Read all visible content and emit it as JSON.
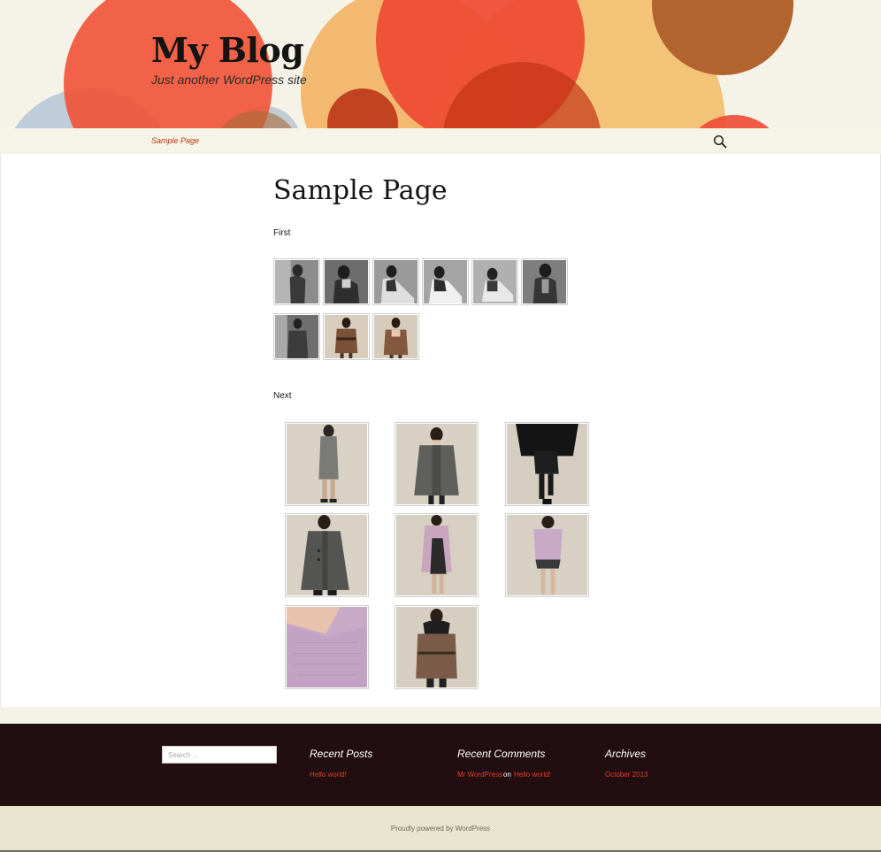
{
  "header": {
    "site_title": "My Blog",
    "tagline": "Just another WordPress site",
    "colors": {
      "background": "#f5f3e8",
      "circle_red": "#e8452e",
      "circle_orange": "#f08a2c",
      "circle_light": "#f2c27a",
      "circle_brown": "#b2642e",
      "circle_blue": "#b9c8d8"
    }
  },
  "nav": {
    "links": [
      {
        "label": "Sample Page"
      }
    ],
    "search_icon": "search-icon",
    "accent_color": "#bc360a"
  },
  "page": {
    "title": "Sample Page",
    "galleries": [
      {
        "label": "First",
        "items": [
          {
            "icon": "photo-bw-1"
          },
          {
            "icon": "photo-bw-2"
          },
          {
            "icon": "photo-bw-3"
          },
          {
            "icon": "photo-bw-4"
          },
          {
            "icon": "photo-bw-5"
          },
          {
            "icon": "photo-bw-6"
          },
          {
            "icon": "photo-bw-7"
          },
          {
            "icon": "photo-brown-1"
          },
          {
            "icon": "photo-brown-2"
          }
        ]
      },
      {
        "label": "Next",
        "items": [
          {
            "icon": "photo-grey-dress"
          },
          {
            "icon": "photo-grey-sweater"
          },
          {
            "icon": "photo-black-outfit"
          },
          {
            "icon": "photo-grey-coat"
          },
          {
            "icon": "photo-lilac-cardigan"
          },
          {
            "icon": "photo-lilac-top"
          },
          {
            "icon": "photo-lilac-knit"
          },
          {
            "icon": "photo-brown-wrap"
          }
        ]
      }
    ]
  },
  "footer": {
    "search_placeholder": "Search ...",
    "recent_posts": {
      "title": "Recent Posts",
      "items": [
        "Hello world!"
      ]
    },
    "recent_comments": {
      "title": "Recent Comments",
      "author": "Mr WordPress",
      "connector": "on",
      "post": "Hello world!"
    },
    "archives": {
      "title": "Archives",
      "items": [
        "October 2013"
      ]
    },
    "credit": "Proudly powered by WordPress",
    "colors": {
      "background": "#220e10",
      "link": "#e63f2a"
    }
  }
}
